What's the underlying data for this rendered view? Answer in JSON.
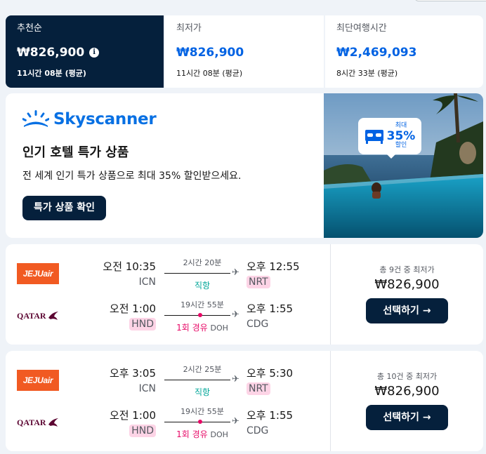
{
  "sort_tabs": [
    {
      "label": "추천순",
      "price": "₩826,900",
      "duration": "11시간 08분 (평균)"
    },
    {
      "label": "최저가",
      "price": "₩826,900",
      "duration": "11시간 08분 (평균)"
    },
    {
      "label": "최단여행시간",
      "price": "₩2,469,093",
      "duration": "8시간 33분 (평균)"
    }
  ],
  "ad": {
    "brand": "Skyscanner",
    "title": "인기 호텔 특가 상품",
    "subtitle": "전 세계 인기 특가 상품으로 최대 35% 할인받으세요.",
    "button": "특가 상품 확인",
    "badge": {
      "top": "최대",
      "percent": "35%",
      "bottom": "할인"
    }
  },
  "flights": [
    {
      "legs": [
        {
          "airline": "JEJUair",
          "depart_time": "오전 10:35",
          "depart_airport": "ICN",
          "duration": "2시간 20분",
          "stops": "직항",
          "via": "",
          "arrive_time": "오후 12:55",
          "arrive_airport": "NRT"
        },
        {
          "airline": "QATAR",
          "depart_time": "오전 1:00",
          "depart_airport": "HND",
          "duration": "19시간 55분",
          "stops": "1회 경유",
          "via": "DOH",
          "arrive_time": "오후 1:55",
          "arrive_airport": "CDG"
        }
      ],
      "deals": "총 9건 중 최저가",
      "price": "₩826,900",
      "button": "선택하기"
    },
    {
      "legs": [
        {
          "airline": "JEJUair",
          "depart_time": "오후 3:05",
          "depart_airport": "ICN",
          "duration": "2시간 25분",
          "stops": "직항",
          "via": "",
          "arrive_time": "오후 5:30",
          "arrive_airport": "NRT"
        },
        {
          "airline": "QATAR",
          "depart_time": "오전 1:00",
          "depart_airport": "HND",
          "duration": "19시간 55분",
          "stops": "1회 경유",
          "via": "DOH",
          "arrive_time": "오후 1:55",
          "arrive_airport": "CDG"
        }
      ],
      "deals": "총 10건 중 최저가",
      "price": "₩826,900",
      "button": "선택하기"
    }
  ],
  "colors": {
    "navy": "#05203c",
    "blue": "#0062e3",
    "direct_green": "#00a698",
    "stop_pink": "#e70866",
    "airport_highlight": "#fdd4e6"
  },
  "icons": {
    "info": "info-icon",
    "plane": "plane-icon",
    "arrow": "arrow-right-icon",
    "logo": "skyscanner-sunrise-logo",
    "bed": "bed-icon"
  }
}
